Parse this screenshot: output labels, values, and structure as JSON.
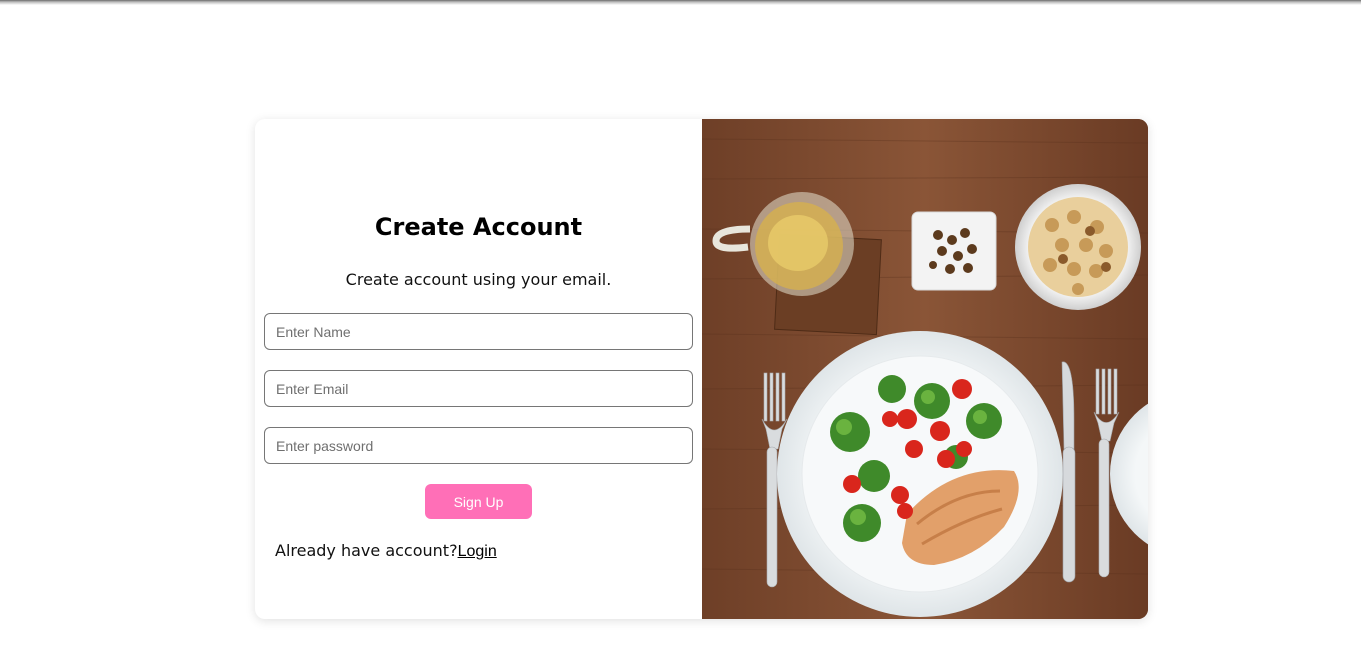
{
  "signup": {
    "title": "Create Account",
    "subtitle": "Create account using your email.",
    "name_placeholder": "Enter Name",
    "email_placeholder": "Enter Email",
    "password_placeholder": "Enter password",
    "submit_label": "Sign Up",
    "login_prompt": "Already have account?",
    "login_link": "Login"
  },
  "colors": {
    "accent": "#ff6fb7",
    "card_bg": "#ffffff"
  },
  "image": {
    "icon": "food-plate-photo"
  }
}
